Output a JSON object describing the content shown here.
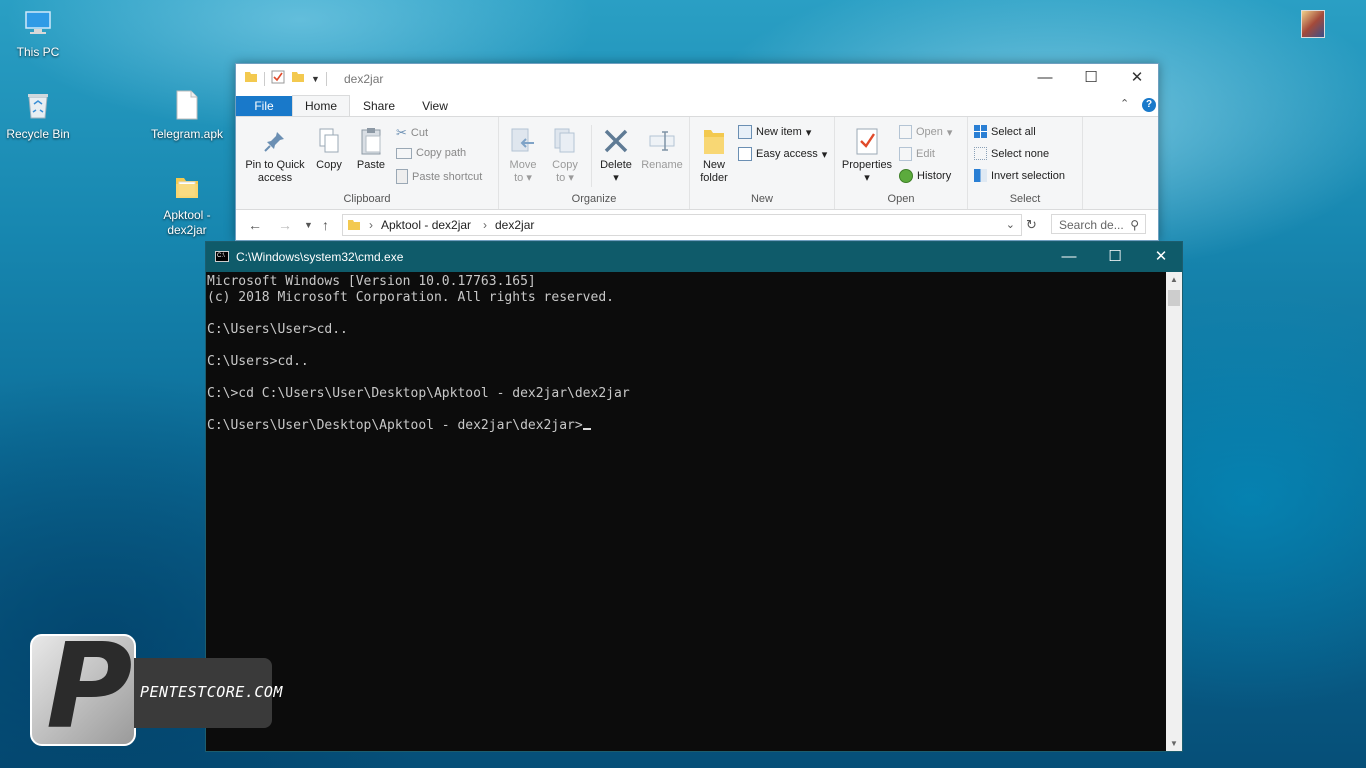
{
  "desktop": {
    "icons": [
      {
        "label": "This PC"
      },
      {
        "label": "Recycle Bin"
      },
      {
        "label": "Telegram.apk"
      },
      {
        "label_line1": "Apktool -",
        "label_line2": "dex2jar"
      }
    ]
  },
  "explorer": {
    "title": "dex2jar",
    "tabs": [
      "File",
      "Home",
      "Share",
      "View"
    ],
    "clipboard": {
      "pin_line1": "Pin to Quick",
      "pin_line2": "access",
      "copy": "Copy",
      "paste": "Paste",
      "cut": "Cut",
      "copy_path": "Copy path",
      "paste_shortcut": "Paste shortcut",
      "label": "Clipboard"
    },
    "organize": {
      "move_line1": "Move",
      "move_line2": "to",
      "copy_line1": "Copy",
      "copy_line2": "to",
      "delete": "Delete",
      "rename": "Rename",
      "label": "Organize"
    },
    "new": {
      "folder_line1": "New",
      "folder_line2": "folder",
      "new_item": "New item",
      "easy_access": "Easy access",
      "label": "New"
    },
    "open": {
      "properties": "Properties",
      "open": "Open",
      "edit": "Edit",
      "history": "History",
      "label": "Open"
    },
    "select": {
      "select_all": "Select all",
      "select_none": "Select none",
      "invert": "Invert selection",
      "label": "Select"
    },
    "address": {
      "crumb1": "Apktool - dex2jar",
      "crumb2": "dex2jar",
      "search_placeholder": "Search de..."
    }
  },
  "cmd": {
    "title": "C:\\Windows\\system32\\cmd.exe",
    "lines": [
      "Microsoft Windows [Version 10.0.17763.165]",
      "(c) 2018 Microsoft Corporation. All rights reserved.",
      "",
      "C:\\Users\\User>cd..",
      "",
      "C:\\Users>cd..",
      "",
      "C:\\>cd C:\\Users\\User\\Desktop\\Apktool - dex2jar\\dex2jar",
      "",
      "C:\\Users\\User\\Desktop\\Apktool - dex2jar\\dex2jar>"
    ]
  },
  "watermark": {
    "letter": "P",
    "text": "PENTESTCORE.COM"
  },
  "colors": {
    "cmd_title_bar": "#0f5b6a",
    "file_tab": "#1979ca"
  }
}
